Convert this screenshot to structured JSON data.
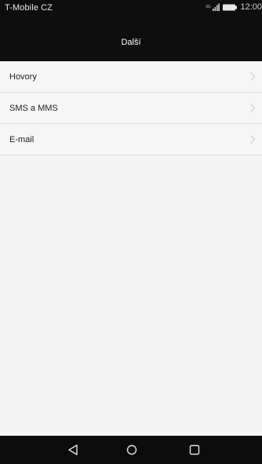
{
  "status_bar": {
    "carrier": "T-Mobile CZ",
    "time": "12:00",
    "icons": [
      "signal-icon",
      "battery-icon"
    ]
  },
  "header": {
    "title": "Další"
  },
  "menu": {
    "items": [
      {
        "label": "Hovory",
        "icon": "chevron-right-icon"
      },
      {
        "label": "SMS a MMS",
        "icon": "chevron-right-icon"
      },
      {
        "label": "E-mail",
        "icon": "chevron-right-icon"
      }
    ]
  },
  "nav_bar": {
    "buttons": [
      "back-icon",
      "home-icon",
      "recent-apps-icon"
    ]
  },
  "colors": {
    "bar_background": "#0e0e0e",
    "list_background": "#f4f4f4",
    "divider": "#e1e1e1",
    "text": "#222222"
  }
}
